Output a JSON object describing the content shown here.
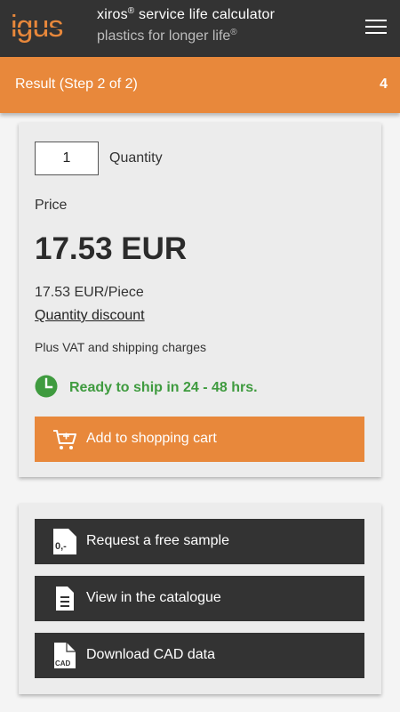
{
  "header": {
    "logo_text": "igus",
    "title_prefix": "xiros",
    "title_reg": "®",
    "title_suffix": " service life calculator",
    "subtitle_prefix": "plastics for longer life",
    "subtitle_reg": "®",
    "menu_icon": "hamburger-menu-icon"
  },
  "stepbar": {
    "label": "Result (Step 2 of 2)",
    "count": "4"
  },
  "colors": {
    "accent_orange": "#e8883b",
    "dark": "#333333",
    "ship_green": "#3f9b3f",
    "card_bg": "#ececec"
  },
  "product": {
    "quantity_value": "1",
    "quantity_label": "Quantity",
    "price_label": "Price",
    "price": "17.53 EUR",
    "price_per_piece": "17.53 EUR/Piece",
    "quantity_discount": "Quantity discount",
    "vat_note": "Plus VAT and shipping charges",
    "ship_icon": "clock-icon",
    "ship_text": "Ready to ship in 24 - 48 hrs.",
    "cart_icon": "shopping-cart-icon",
    "cart_label": "Add to shopping cart"
  },
  "actions": {
    "sample_icon": "free-sample-icon",
    "sample_icon_text": "0,-",
    "sample_label": "Request a free sample",
    "catalogue_icon": "document-icon",
    "catalogue_label": "View in the catalogue",
    "cad_icon": "cad-file-icon",
    "cad_icon_text": "CAD",
    "cad_label": "Download CAD data"
  }
}
